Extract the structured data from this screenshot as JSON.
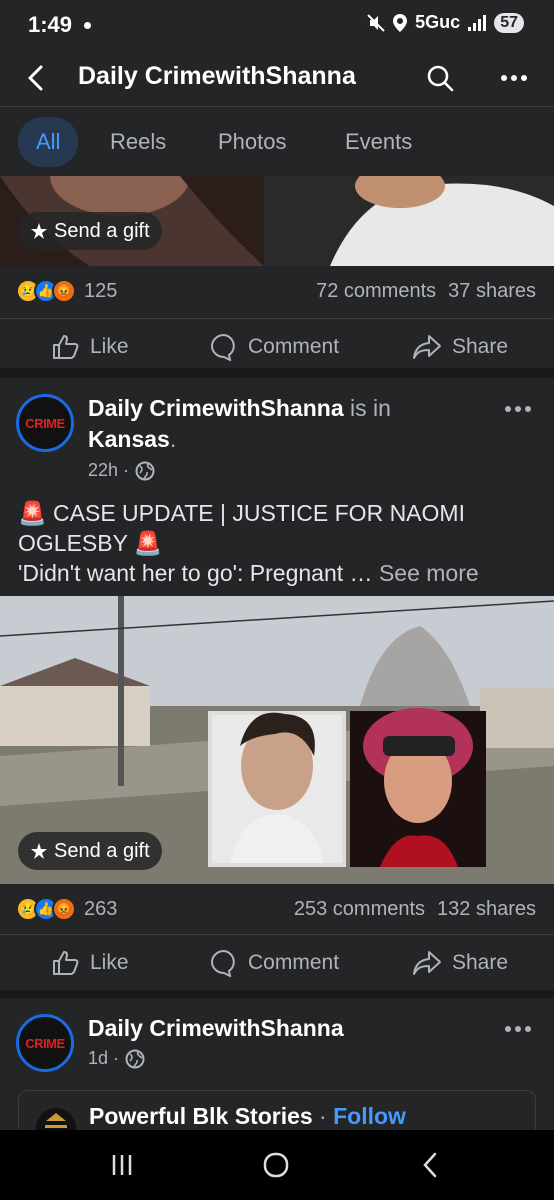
{
  "status": {
    "time": "1:49",
    "network": "5Guc",
    "battery": "57"
  },
  "header": {
    "title": "Daily CrimewithShanna"
  },
  "tabs": [
    {
      "label": "All",
      "active": true
    },
    {
      "label": "Reels",
      "active": false
    },
    {
      "label": "Photos",
      "active": false
    },
    {
      "label": "Events",
      "active": false
    }
  ],
  "post1": {
    "gift_label": "Send a gift",
    "reaction_count": "125",
    "comments": "72 comments",
    "shares": "37 shares"
  },
  "actions": {
    "like": "Like",
    "comment": "Comment",
    "share": "Share"
  },
  "post2": {
    "author": "Daily CrimewithShanna",
    "is_in": "is in",
    "location": "Kansas",
    "location_suffix": ".",
    "time": "22h ·",
    "avatar_text": "CRIME",
    "headline": "CASE UPDATE | JUSTICE FOR NAOMI OGLESBY",
    "body": "'Didn't want her to go': Pregnant …",
    "see_more": "See more",
    "gift_label": "Send a gift",
    "reaction_count": "263",
    "comments": "253 comments",
    "shares": "132 shares"
  },
  "post3": {
    "author": "Daily CrimewithShanna",
    "time": "1d ·",
    "avatar_text": "CRIME",
    "shared_page": "Powerful Blk Stories",
    "separator": " · ",
    "follow_label": "Follow"
  },
  "colors": {
    "accent": "#4599ff",
    "background": "#18191a",
    "card": "#242526"
  },
  "icons": [
    "back-arrow-icon",
    "search-icon",
    "more-icon",
    "gift-icon",
    "like-icon",
    "comment-icon",
    "share-icon",
    "globe-icon",
    "siren-icon"
  ]
}
